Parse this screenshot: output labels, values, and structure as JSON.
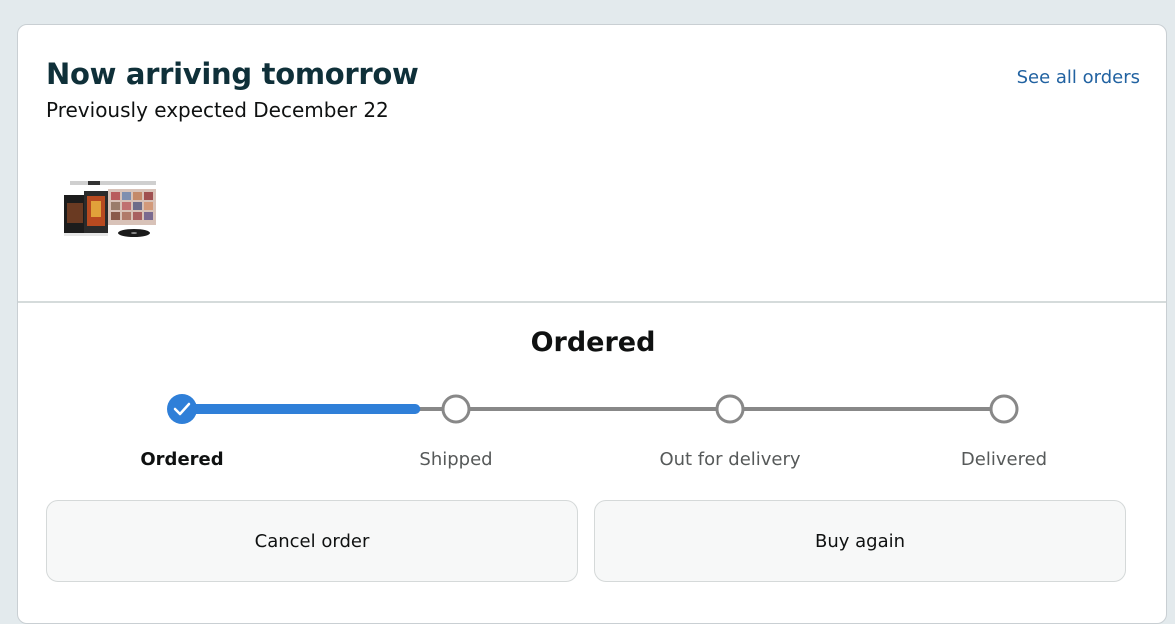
{
  "header": {
    "title": "Now arriving tomorrow",
    "subtitle": "Previously expected December 22",
    "see_all_link": "See all orders"
  },
  "product": {
    "image_alt": "Blu-ray box set product image"
  },
  "status": {
    "title": "Ordered",
    "progress_fraction": 0.33,
    "steps": [
      {
        "label": "Ordered",
        "state": "complete"
      },
      {
        "label": "Shipped",
        "state": "pending"
      },
      {
        "label": "Out for delivery",
        "state": "pending"
      },
      {
        "label": "Delivered",
        "state": "pending"
      }
    ]
  },
  "actions": {
    "cancel_label": "Cancel order",
    "buy_again_label": "Buy again"
  },
  "colors": {
    "accent": "#2f7fd8",
    "link": "#2162a1",
    "track": "#888888"
  }
}
